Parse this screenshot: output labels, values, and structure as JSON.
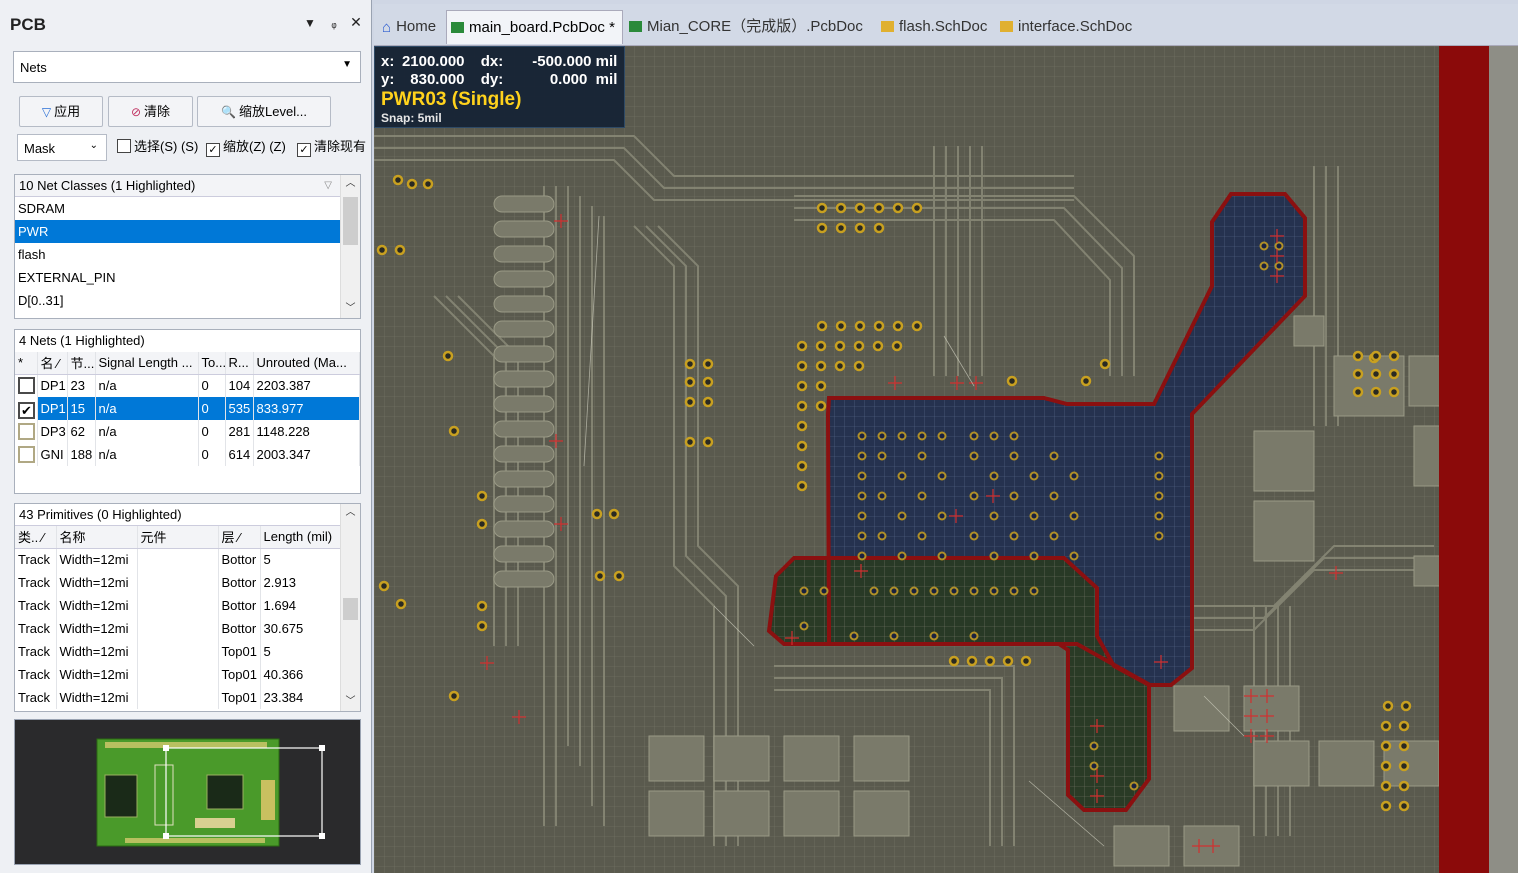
{
  "panel": {
    "title": "PCB",
    "pin_icon": "pin-icon",
    "dropdown_icon": "chevron-down-icon",
    "close_icon": "close-icon",
    "mode_select": "Nets",
    "buttons": {
      "apply": "应用",
      "clear": "清除",
      "zoom": "缩放Level..."
    },
    "mask_select": "Mask",
    "checkboxes": [
      {
        "label": "选择(S) (S)",
        "checked": false
      },
      {
        "label": "缩放(Z) (Z)",
        "checked": true
      },
      {
        "label": "清除现有",
        "checked": true
      }
    ],
    "net_classes": {
      "header": "10 Net Classes (1 Highlighted)",
      "items": [
        "SDRAM",
        "PWR",
        "flash",
        "EXTERNAL_PIN",
        "D[0..31]"
      ]
    },
    "nets": {
      "header": "4 Nets (1 Highlighted)",
      "columns": [
        "*",
        "名 ⁄",
        "节...",
        "Signal Length ...",
        "To...",
        "R...",
        "Unrouted (Ma..."
      ],
      "rows": [
        {
          "checked": false,
          "name": "DP1",
          "nodes": "23",
          "signal": "n/a",
          "to": "0",
          "r": "104",
          "unrouted": "2203.387"
        },
        {
          "checked": true,
          "name": "DP1",
          "nodes": "15",
          "signal": "n/a",
          "to": "0",
          "r": "535",
          "unrouted": "833.977"
        },
        {
          "checked": false,
          "name": "DP3",
          "nodes": "62",
          "signal": "n/a",
          "to": "0",
          "r": "281",
          "unrouted": "1148.228"
        },
        {
          "checked": false,
          "name": "GNI",
          "nodes": "188",
          "signal": "n/a",
          "to": "0",
          "r": "614",
          "unrouted": "2003.347"
        }
      ]
    },
    "primitives": {
      "header": "43 Primitives (0 Highlighted)",
      "columns": [
        "类.. ⁄",
        "名称",
        "元件",
        "层 ⁄",
        "Length (mil)"
      ],
      "rows": [
        {
          "type": "Track",
          "name": "Width=12mi",
          "comp": "",
          "layer": "Bottor",
          "length": "5"
        },
        {
          "type": "Track",
          "name": "Width=12mi",
          "comp": "",
          "layer": "Bottor",
          "length": "2.913"
        },
        {
          "type": "Track",
          "name": "Width=12mi",
          "comp": "",
          "layer": "Bottor",
          "length": "1.694"
        },
        {
          "type": "Track",
          "name": "Width=12mi",
          "comp": "",
          "layer": "Bottor",
          "length": "30.675"
        },
        {
          "type": "Track",
          "name": "Width=12mi",
          "comp": "",
          "layer": "Top01",
          "length": "5"
        },
        {
          "type": "Track",
          "name": "Width=12mi",
          "comp": "",
          "layer": "Top01",
          "length": "40.366"
        },
        {
          "type": "Track",
          "name": "Width=12mi",
          "comp": "",
          "layer": "Top01",
          "length": "23.384"
        }
      ]
    }
  },
  "tabs": [
    {
      "label": "Home",
      "icon": "home-icon",
      "active": false
    },
    {
      "label": "main_board.PcbDoc *",
      "icon": "pcb-doc-icon",
      "active": true
    },
    {
      "label": "Mian_CORE（完成版）.PcbDoc",
      "icon": "pcb-doc-icon",
      "active": false
    },
    {
      "label": "flash.SchDoc",
      "icon": "sch-doc-icon",
      "active": false
    },
    {
      "label": "interface.SchDoc",
      "icon": "sch-doc-icon",
      "active": false
    }
  ],
  "hud": {
    "x_label": "x:",
    "x": "2100.000",
    "dx_label": "dx:",
    "dx": "-500.000 mil",
    "y_label": "y:",
    "y": "830.000",
    "dy_label": "dy:",
    "dy": "0.000  mil",
    "net": "PWR03 (Single)",
    "snap": "Snap: 5mil"
  },
  "colors": {
    "highlight": "#0078d7",
    "board": "#5a5a4e",
    "outline": "#8b1010",
    "net_fill": "#2a3a66",
    "net_fill2": "#2c4a2a",
    "pad": "#c8a020"
  }
}
